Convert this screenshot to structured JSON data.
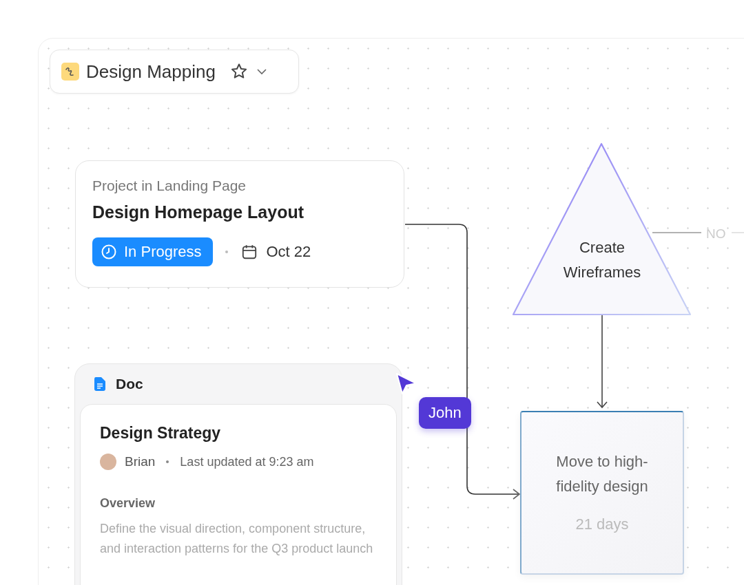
{
  "board": {
    "title": "Design Mapping"
  },
  "task_card": {
    "project": "Project in Landing Page",
    "title": "Design Homepage Layout",
    "status": "In Progress",
    "date": "Oct 22"
  },
  "doc_card": {
    "label": "Doc",
    "title": "Design Strategy",
    "author": "Brian",
    "updated": "Last updated at 9:23 am",
    "section": "Overview",
    "body": "Define the visual direction, component structure, and interaction patterns for the Q3 product launch"
  },
  "cursor": {
    "name": "John"
  },
  "decision": {
    "label": "Create Wireframes",
    "branch": "NO"
  },
  "step": {
    "title": "Move to high-fidelity design",
    "duration": "21 days"
  }
}
